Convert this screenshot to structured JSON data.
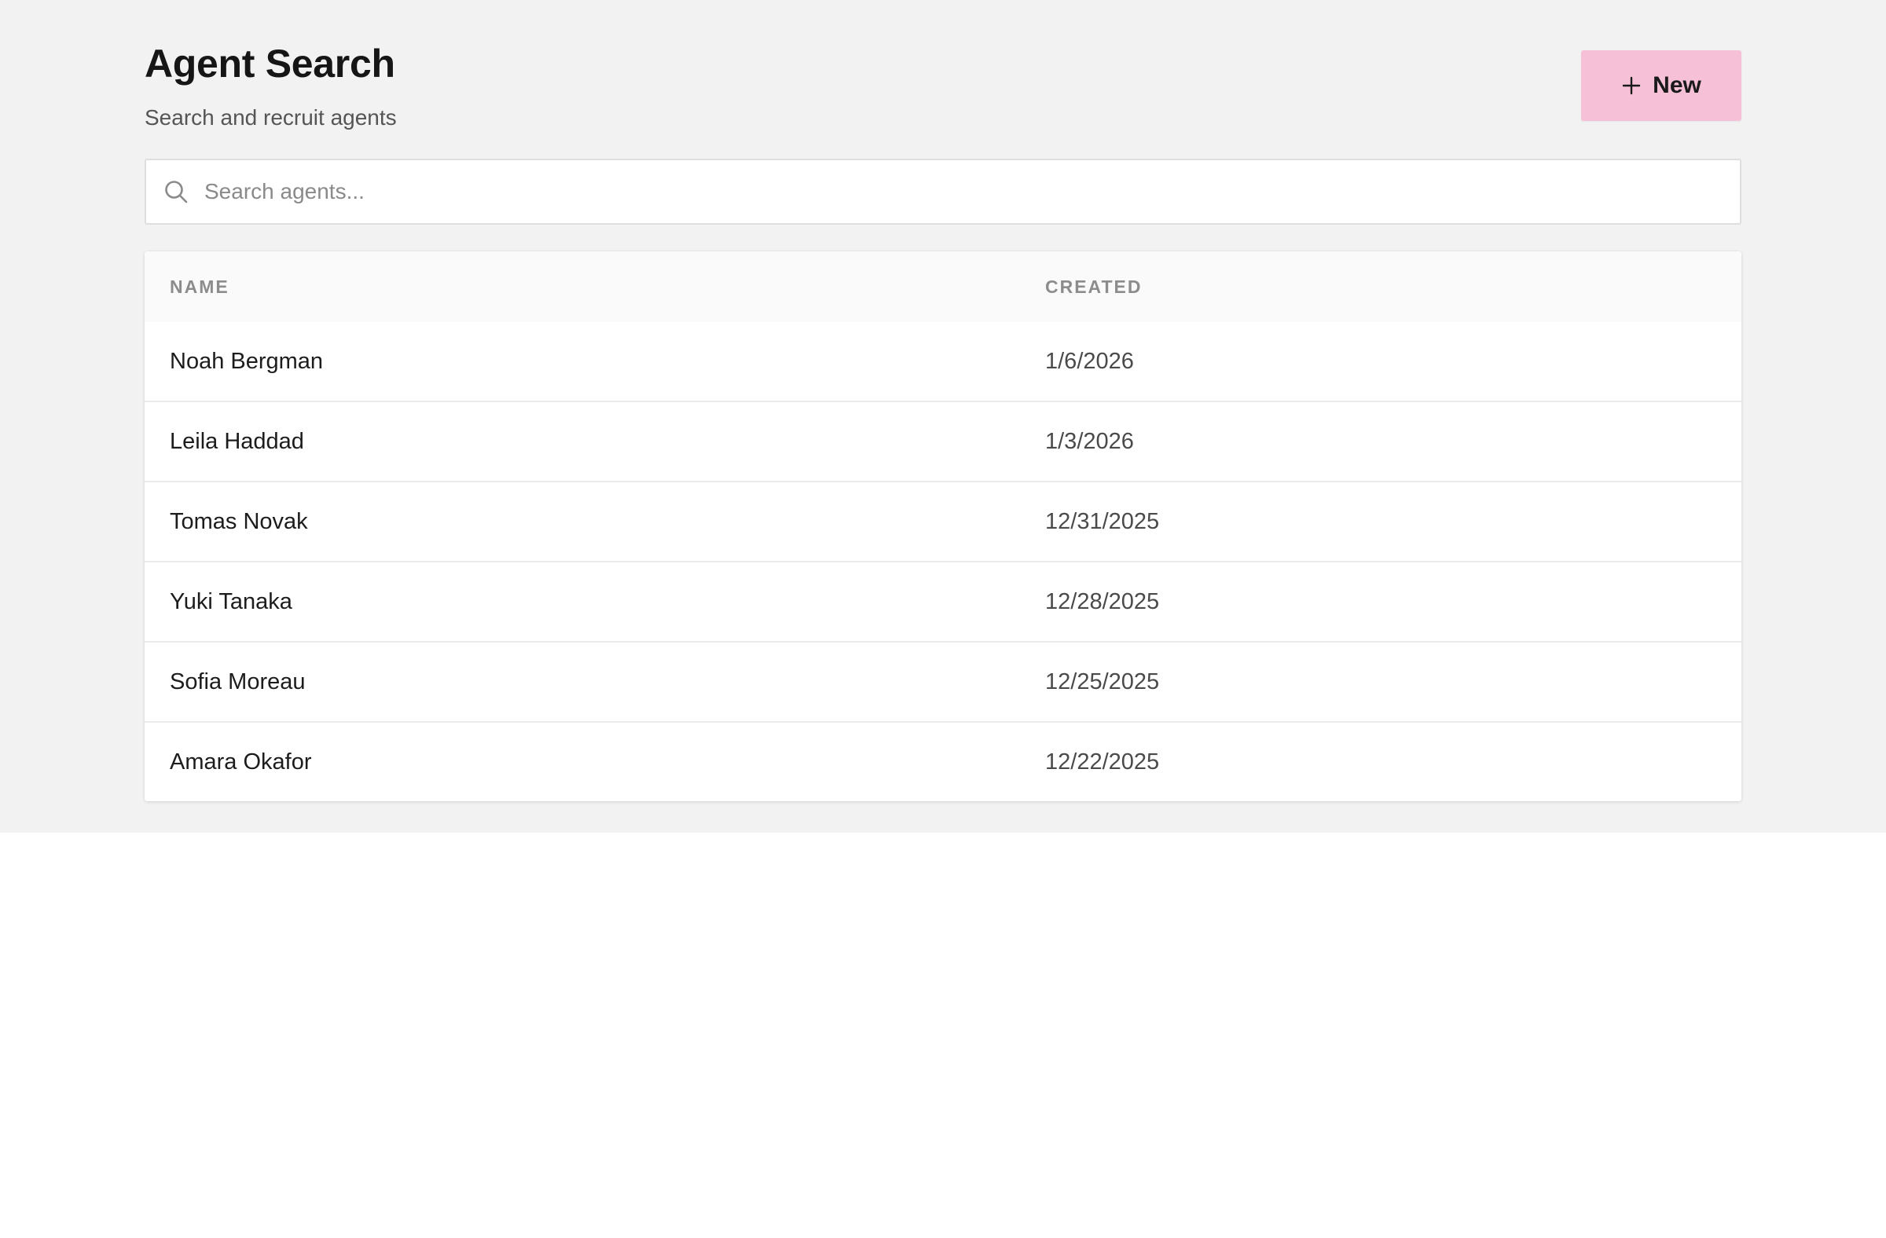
{
  "header": {
    "title": "Agent Search",
    "subtitle": "Search and recruit agents",
    "new_button_label": "New"
  },
  "search": {
    "placeholder": "Search agents...",
    "value": ""
  },
  "table": {
    "columns": [
      "NAME",
      "CREATED"
    ],
    "rows": [
      {
        "name": "Noah Bergman",
        "created": "1/6/2026"
      },
      {
        "name": "Leila Haddad",
        "created": "1/3/2026"
      },
      {
        "name": "Tomas Novak",
        "created": "12/31/2025"
      },
      {
        "name": "Yuki Tanaka",
        "created": "12/28/2025"
      },
      {
        "name": "Sofia Moreau",
        "created": "12/25/2025"
      },
      {
        "name": "Amara Okafor",
        "created": "12/22/2025"
      }
    ]
  },
  "icons": {
    "search": "search-icon",
    "new": "plus-icon"
  },
  "colors": {
    "accent_button": "#f6c1d6",
    "page_background": "#f2f2f2"
  }
}
